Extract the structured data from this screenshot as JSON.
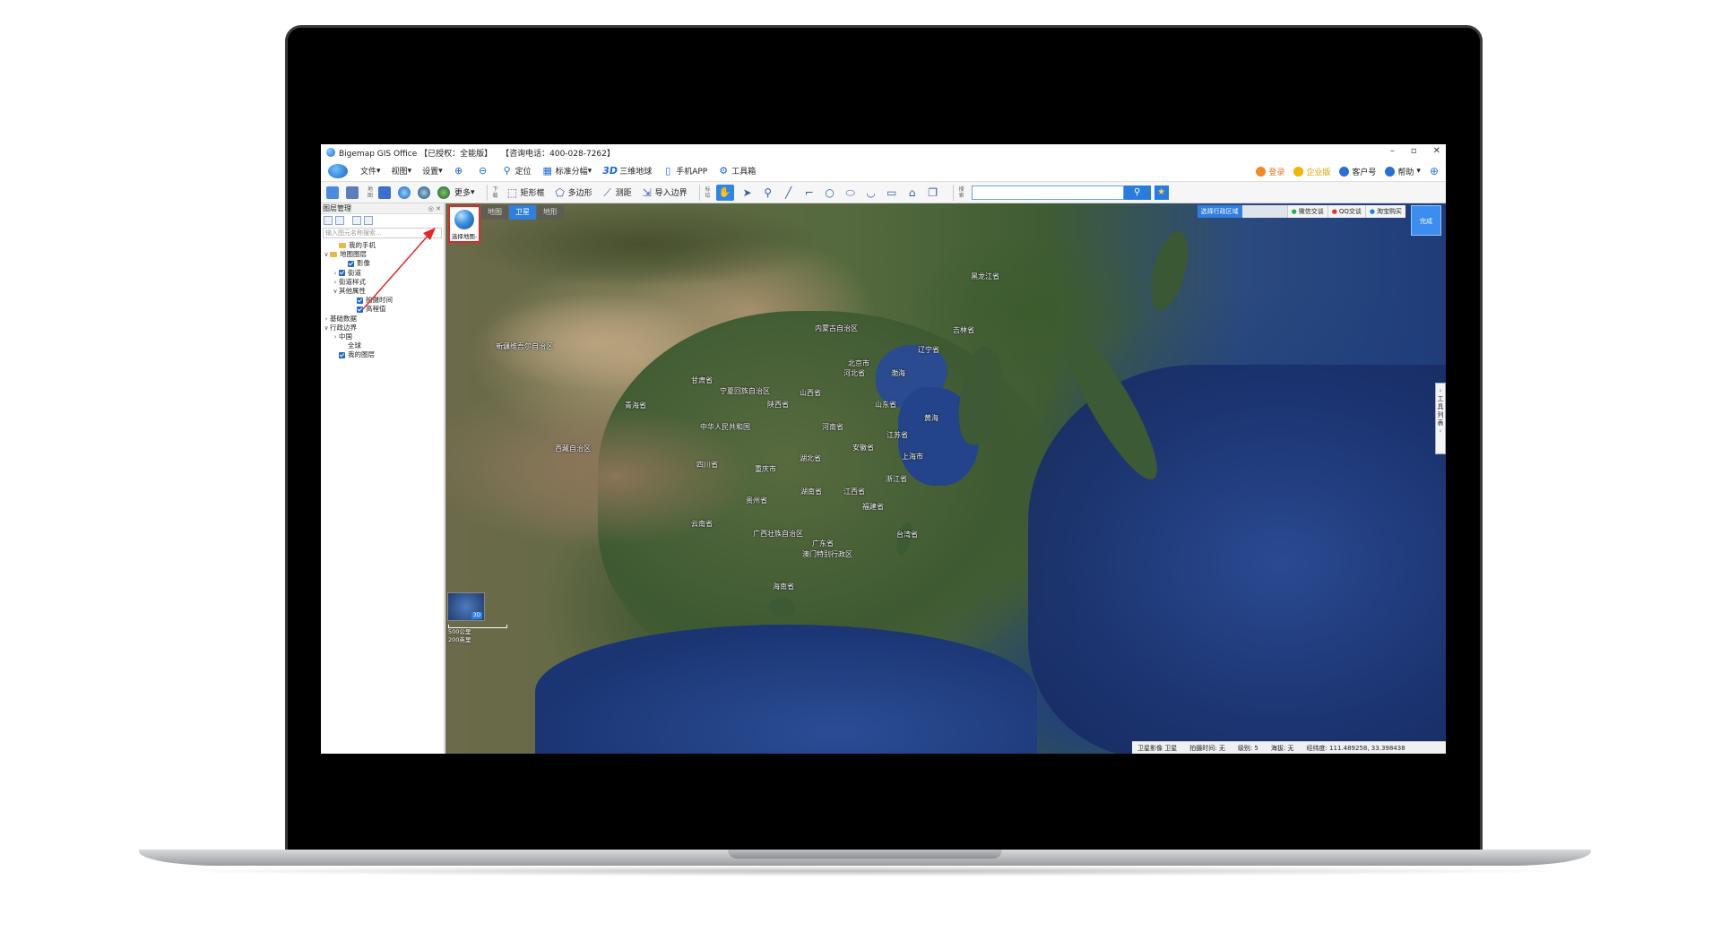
{
  "window": {
    "title": "Bigemap GIS Office 【已授权：全能版】",
    "phone": "【咨询电话：400-028-7262】",
    "controls": [
      "–",
      "▫",
      "✕"
    ]
  },
  "menubar": {
    "items": [
      {
        "label": "文件",
        "icon": "file-icon"
      },
      {
        "label": "视图",
        "icon": "view-icon"
      },
      {
        "label": "设置",
        "icon": "settings-icon"
      },
      {
        "label": "",
        "icon": "zoom-in-icon"
      },
      {
        "label": "",
        "icon": "zoom-out-icon"
      },
      {
        "label": "定位",
        "icon": "location-pin-icon"
      },
      {
        "label": "标准分幅",
        "icon": "grid-icon"
      },
      {
        "label": "三维地球",
        "icon": "3d-icon"
      },
      {
        "label": "手机APP",
        "icon": "phone-icon"
      },
      {
        "label": "工具箱",
        "icon": "gear-icon"
      }
    ],
    "right": [
      {
        "label": "登录",
        "color": "#f08a24"
      },
      {
        "label": "企业版",
        "color": "#f5b400"
      },
      {
        "label": "客户号",
        "color": "#2a6fd6"
      },
      {
        "label": "帮助",
        "color": "#2a6fd6"
      }
    ]
  },
  "toolbar": {
    "label_left": "地图",
    "more": "更多",
    "download_label": "下载",
    "rect_label": "矩形框",
    "polygon_label": "多边形",
    "measure_label": "测距",
    "import_label": "导入边界",
    "annotate_label": "标绘",
    "search_label": "搜索"
  },
  "panel": {
    "title": "图层管理",
    "search_placeholder": "输入图元名称搜索...",
    "tree": [
      {
        "label": "我的手机",
        "indent": 1,
        "type": "folder",
        "caret": ""
      },
      {
        "label": "地图图层",
        "indent": 0,
        "type": "folder",
        "caret": "∨"
      },
      {
        "label": "影像",
        "indent": 2,
        "type": "check",
        "caret": ""
      },
      {
        "label": "街道",
        "indent": 1,
        "type": "check",
        "caret": "›"
      },
      {
        "label": "街道样式",
        "indent": 1,
        "type": "none",
        "caret": "›"
      },
      {
        "label": "其他属性",
        "indent": 1,
        "type": "none",
        "caret": "∨"
      },
      {
        "label": "拍摄时间",
        "indent": 3,
        "type": "check",
        "caret": ""
      },
      {
        "label": "高程值",
        "indent": 3,
        "type": "check",
        "caret": ""
      },
      {
        "label": "基础数据",
        "indent": 0,
        "type": "none",
        "caret": "›"
      },
      {
        "label": "行政边界",
        "indent": 0,
        "type": "none",
        "caret": "∨"
      },
      {
        "label": "中国",
        "indent": 1,
        "type": "none",
        "caret": "›"
      },
      {
        "label": "全球",
        "indent": 2,
        "type": "none",
        "caret": ""
      },
      {
        "label": "我的图层",
        "indent": 1,
        "type": "check",
        "caret": ""
      }
    ]
  },
  "map": {
    "tabs": [
      {
        "label": "地图",
        "active": false
      },
      {
        "label": "卫星",
        "active": true
      },
      {
        "label": "地形",
        "active": false
      }
    ],
    "selector_label": "选择地图-",
    "region_button": "选择行政区域",
    "contacts": [
      "微信交谈",
      "QQ交谈",
      "淘宝购买"
    ],
    "done_button": "完成",
    "side_toolbox": "工具列表",
    "minimap_badge": "3D",
    "scale": [
      "500公里",
      "200英里"
    ],
    "places": [
      {
        "name": "黑龙江省"
      },
      {
        "name": "内蒙古自治区"
      },
      {
        "name": "吉林省"
      },
      {
        "name": "新疆维吾尔自治区"
      },
      {
        "name": "辽宁省"
      },
      {
        "name": "北京市"
      },
      {
        "name": "河北省"
      },
      {
        "name": "渤海"
      },
      {
        "name": "甘肃省"
      },
      {
        "name": "宁夏回族自治区"
      },
      {
        "name": "山西省"
      },
      {
        "name": "青海省"
      },
      {
        "name": "陕西省"
      },
      {
        "name": "山东省"
      },
      {
        "name": "中华人民共和国"
      },
      {
        "name": "河南省"
      },
      {
        "name": "黄海"
      },
      {
        "name": "江苏省"
      },
      {
        "name": "西藏自治区"
      },
      {
        "name": "安徽省"
      },
      {
        "name": "湖北省"
      },
      {
        "name": "上海市"
      },
      {
        "name": "四川省"
      },
      {
        "name": "重庆市"
      },
      {
        "name": "浙江省"
      },
      {
        "name": "江西省"
      },
      {
        "name": "贵州省"
      },
      {
        "name": "湖南省"
      },
      {
        "name": "福建省"
      },
      {
        "name": "云南省"
      },
      {
        "name": "广西壮族自治区"
      },
      {
        "name": "广东省"
      },
      {
        "name": "台湾省"
      },
      {
        "name": "澳门特别行政区"
      },
      {
        "name": "海南省"
      }
    ],
    "status": {
      "layer": "卫星影像 卫星",
      "capture_time": "拍摄时间: 无",
      "level": "级别: 5",
      "elevation": "海拔: 无",
      "coords": "经纬度: 111.489258, 33.398438"
    }
  }
}
